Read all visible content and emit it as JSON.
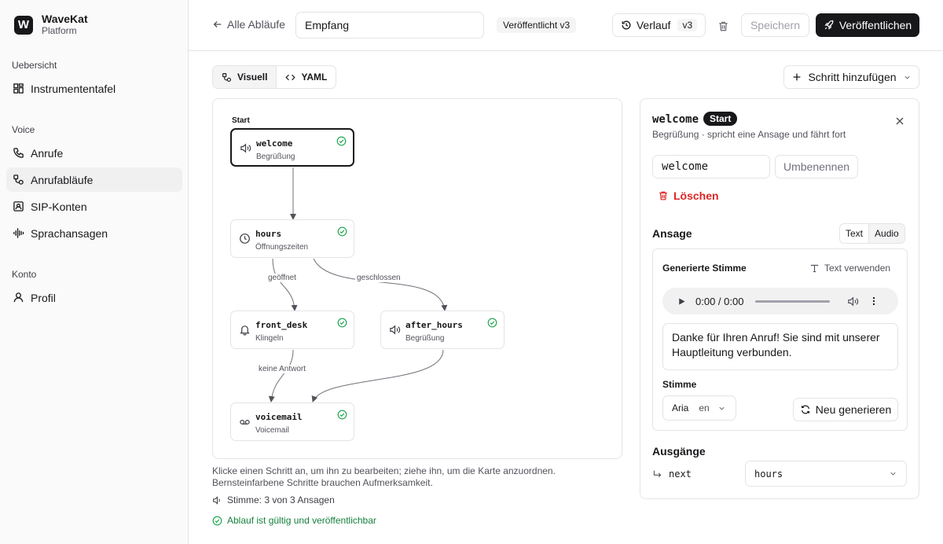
{
  "brand": {
    "logo_letter": "W",
    "name": "WaveKat",
    "subtitle": "Platform"
  },
  "sidebar": {
    "sections": [
      {
        "title": "Uebersicht",
        "items": [
          {
            "label": "Instrumententafel",
            "icon": "grid-icon"
          }
        ]
      },
      {
        "title": "Voice",
        "items": [
          {
            "label": "Anrufe",
            "icon": "phone-icon"
          },
          {
            "label": "Anrufabläufe",
            "icon": "flow-icon",
            "active": true
          },
          {
            "label": "SIP-Konten",
            "icon": "contact-card-icon"
          },
          {
            "label": "Sprachansagen",
            "icon": "audio-wave-icon"
          }
        ]
      },
      {
        "title": "Konto",
        "items": [
          {
            "label": "Profil",
            "icon": "user-icon"
          }
        ]
      }
    ]
  },
  "header": {
    "back_label": "Alle Abläufe",
    "flow_name": "Empfang",
    "status_badge": "Veröffentlicht v3",
    "history_label": "Verlauf",
    "history_version": "v3",
    "save_label": "Speichern",
    "publish_label": "Veröffentlichen"
  },
  "toolbar": {
    "visual_tab": "Visuell",
    "yaml_tab": "YAML",
    "add_step_label": "Schritt hinzufügen"
  },
  "canvas": {
    "start_label": "Start",
    "nodes": [
      {
        "id": "welcome",
        "subtitle": "Begrüßung",
        "icon": "speaker-icon",
        "status": "valid",
        "selected": true
      },
      {
        "id": "hours",
        "subtitle": "Öffnungszeiten",
        "icon": "clock-icon",
        "status": "valid"
      },
      {
        "id": "front_desk",
        "subtitle": "Klingeln",
        "icon": "bell-icon",
        "status": "valid"
      },
      {
        "id": "after_hours",
        "subtitle": "Begrüßung",
        "icon": "speaker-icon",
        "status": "valid"
      },
      {
        "id": "voicemail",
        "subtitle": "Voicemail",
        "icon": "voicemail-icon",
        "status": "valid"
      }
    ],
    "edges": [
      {
        "from": "welcome",
        "to": "hours",
        "label": ""
      },
      {
        "from": "hours",
        "to": "front_desk",
        "label": "geöffnet"
      },
      {
        "from": "hours",
        "to": "after_hours",
        "label": "geschlossen"
      },
      {
        "from": "front_desk",
        "to": "voicemail",
        "label": "keine Antwort"
      },
      {
        "from": "after_hours",
        "to": "voicemail",
        "label": ""
      }
    ]
  },
  "footer": {
    "hint_line1": "Klicke einen Schritt an, um ihn zu bearbeiten; ziehe ihn, um die Karte anzuordnen.",
    "hint_line2": "Bernsteinfarbene Schritte brauchen Aufmerksamkeit.",
    "voice_status": "Stimme: 3 von 3 Ansagen",
    "valid_status": "Ablauf ist gültig und veröffentlichbar"
  },
  "panel": {
    "step_id": "welcome",
    "start_badge": "Start",
    "description": "Begrüßung · spricht eine Ansage und fährt fort",
    "rename_value": "welcome",
    "rename_button": "Umbenennen",
    "delete_button": "Löschen",
    "announcement_title": "Ansage",
    "mode_text": "Text",
    "mode_audio": "Audio",
    "generated_voice_title": "Generierte Stimme",
    "use_text_label": "Text verwenden",
    "audio_time": "0:00 / 0:00",
    "prompt_text": "Danke für Ihren Anruf! Sie sind mit unserer Hauptleitung verbunden.",
    "voice_label": "Stimme",
    "voice_name": "Aria",
    "voice_lang": "en",
    "regenerate_label": "Neu generieren",
    "exits_title": "Ausgänge",
    "exit_name": "next",
    "exit_target": "hours"
  },
  "colors": {
    "accent_dark": "#18181b",
    "success": "#16a34a",
    "danger": "#dc2626",
    "border": "#e4e4e7"
  }
}
